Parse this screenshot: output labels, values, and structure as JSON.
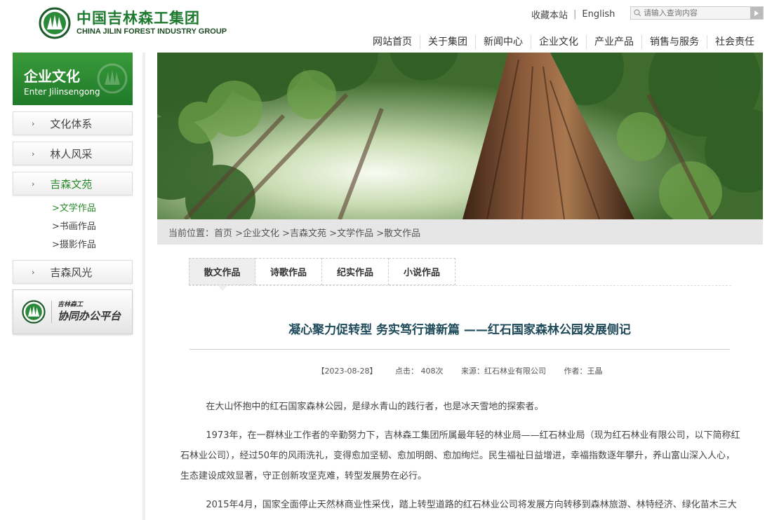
{
  "header": {
    "logo_cn": "中国吉林森工集团",
    "logo_en": "CHINA JILIN FOREST INDUSTRY GROUP",
    "bookmark": "收藏本站",
    "separator": "|",
    "language": "English",
    "search_placeholder": "请输入查询内容"
  },
  "nav": [
    "网站首页",
    "关于集团",
    "新闻中心",
    "企业文化",
    "产业产品",
    "销售与服务",
    "社会责任"
  ],
  "sidebar": {
    "title_cn": "企业文化",
    "title_en": "Enter Jilinsengong",
    "items": [
      {
        "label": "文化体系",
        "arrow": "›"
      },
      {
        "label": "林人风采",
        "arrow": "›"
      },
      {
        "label": "吉森文苑",
        "arrow": "›"
      }
    ],
    "sub_items": [
      ">文学作品",
      ">书画作品",
      ">摄影作品"
    ],
    "last_item": {
      "label": "吉森风光",
      "arrow": "›"
    },
    "office_small": "吉林森工",
    "office_big": "协同办公平台"
  },
  "breadcrumb": "当前位置：首页 >企业文化 >吉森文苑 >文学作品 >散文作品",
  "tabs": [
    "散文作品",
    "诗歌作品",
    "纪实作品",
    "小说作品"
  ],
  "article": {
    "title": "凝心聚力促转型 务实笃行谱新篇 ——红石国家森林公园发展侧记",
    "date": "【2023-08-28】",
    "views": "点击： 408次",
    "source": "来源：红石林业有限公司",
    "author": "作者：王晶",
    "paragraphs": [
      "在大山怀抱中的红石国家森林公园，是绿水青山的践行者，也是冰天雪地的探索者。",
      "1973年，在一群林业工作者的辛勤努力下，吉林森工集团所属最年轻的林业局——红石林业局（现为红石林业有限公司，以下简称红石林业公司），经过50年的风雨洗礼，变得愈加坚韧、愈加明朗、愈加绚烂。民生福祉日益增进，幸福指数逐年攀升，养山富山深入人心，生态建设成效显著，守正创新攻坚克难，转型发展势在必行。",
      "2015年4月，国家全面停止天然林商业性采伐，踏上转型道路的红石林业公司将发展方向转移到森林旅游、林特经济、绿化苗木三大"
    ]
  },
  "colors": {
    "brand_green": "#1e7a2e",
    "title_blue": "#1e4a5a",
    "active_green": "#2a8a2a"
  }
}
